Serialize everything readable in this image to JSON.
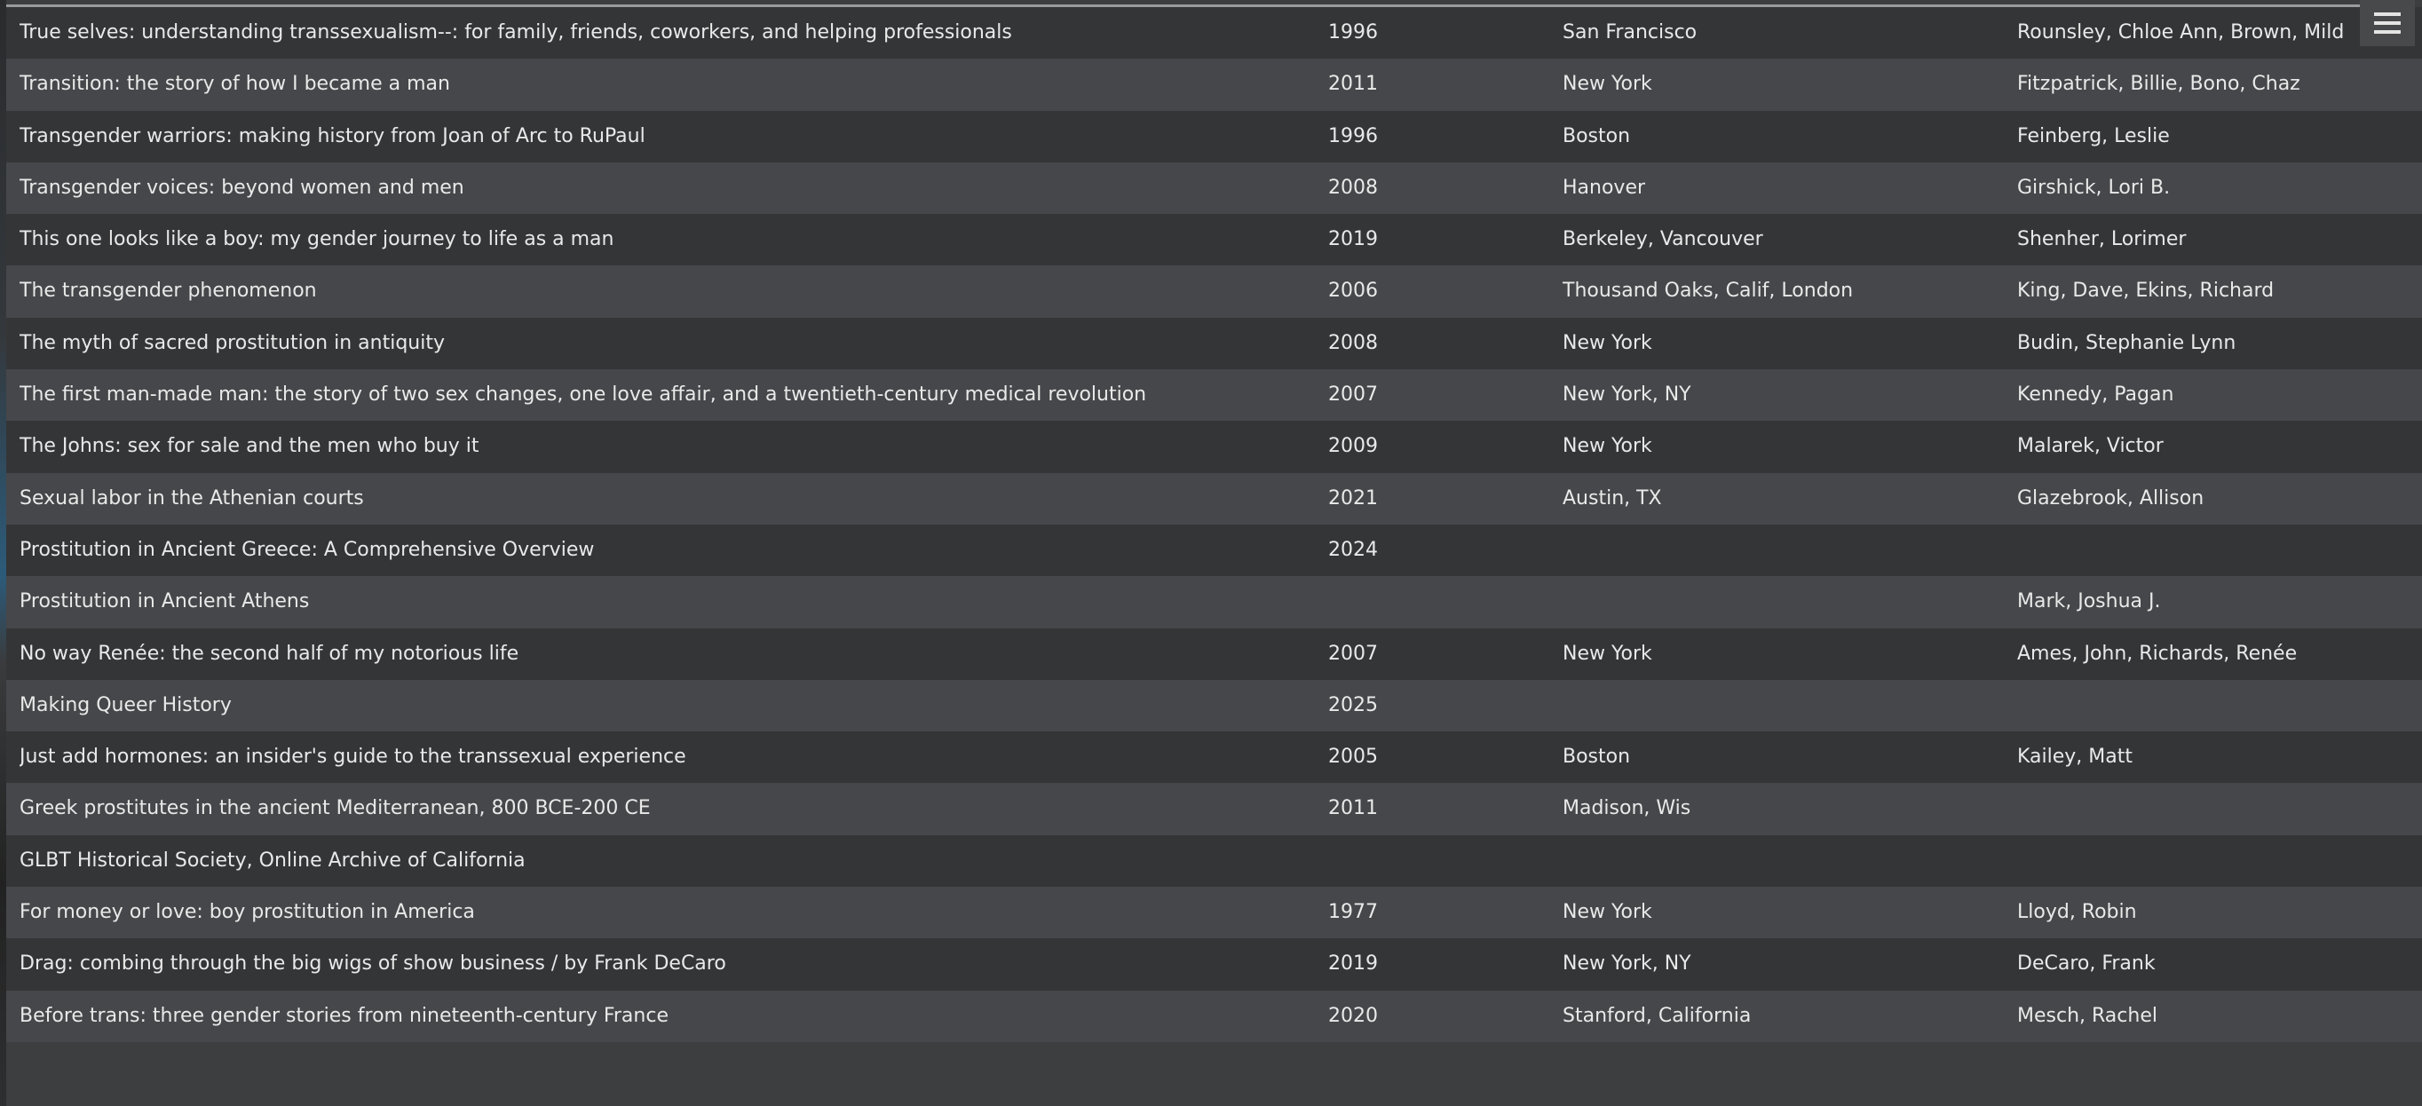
{
  "table": {
    "rows": [
      {
        "title": "True selves: understanding transsexualism--: for family, friends, coworkers, and helping professionals",
        "year": "1996",
        "place": "San Francisco",
        "author": "Rounsley, Chloe Ann, Brown, Mild"
      },
      {
        "title": "Transition: the story of how I became a man",
        "year": "2011",
        "place": "New York",
        "author": "Fitzpatrick, Billie, Bono, Chaz"
      },
      {
        "title": "Transgender warriors: making history from Joan of Arc to RuPaul",
        "year": "1996",
        "place": "Boston",
        "author": "Feinberg, Leslie"
      },
      {
        "title": "Transgender voices: beyond women and men",
        "year": "2008",
        "place": "Hanover",
        "author": "Girshick, Lori B."
      },
      {
        "title": "This one looks like a boy: my gender journey to life as a man",
        "year": "2019",
        "place": "Berkeley, Vancouver",
        "author": "Shenher, Lorimer"
      },
      {
        "title": "The transgender phenomenon",
        "year": "2006",
        "place": "Thousand Oaks, Calif, London",
        "author": "King, Dave, Ekins, Richard"
      },
      {
        "title": "The myth of sacred prostitution in antiquity",
        "year": "2008",
        "place": "New York",
        "author": "Budin, Stephanie Lynn"
      },
      {
        "title": "The first man-made man: the story of two sex changes, one love affair, and a twentieth-century medical revolution",
        "year": "2007",
        "place": "New York, NY",
        "author": "Kennedy, Pagan"
      },
      {
        "title": "The Johns: sex for sale and the men who buy it",
        "year": "2009",
        "place": "New York",
        "author": "Malarek, Victor"
      },
      {
        "title": "Sexual labor in the Athenian courts",
        "year": "2021",
        "place": "Austin, TX",
        "author": "Glazebrook, Allison"
      },
      {
        "title": "Prostitution in Ancient Greece: A Comprehensive Overview",
        "year": "2024",
        "place": "",
        "author": ""
      },
      {
        "title": "Prostitution in Ancient Athens",
        "year": "",
        "place": "",
        "author": "Mark, Joshua J."
      },
      {
        "title": "No way Renée: the second half of my notorious life",
        "year": "2007",
        "place": "New York",
        "author": "Ames, John, Richards, Renée"
      },
      {
        "title": "Making Queer History",
        "year": "2025",
        "place": "",
        "author": ""
      },
      {
        "title": "Just add hormones: an insider's guide to the transsexual experience",
        "year": "2005",
        "place": "Boston",
        "author": "Kailey, Matt"
      },
      {
        "title": "Greek prostitutes in the ancient Mediterranean, 800 BCE-200 CE",
        "year": "2011",
        "place": "Madison, Wis",
        "author": ""
      },
      {
        "title": "GLBT Historical Society, Online Archive of California",
        "year": "",
        "place": "",
        "author": ""
      },
      {
        "title": "For money or love: boy prostitution in America",
        "year": "1977",
        "place": "New York",
        "author": "Lloyd, Robin"
      },
      {
        "title": "Drag: combing through the big wigs of show business / by Frank DeCaro",
        "year": "2019",
        "place": "New York, NY",
        "author": "DeCaro, Frank"
      },
      {
        "title": "Before trans: three gender stories from nineteenth-century France",
        "year": "2020",
        "place": "Stanford, California",
        "author": "Mesch, Rachel"
      }
    ]
  },
  "menu_button": {
    "icon": "hamburger-menu-icon"
  },
  "colors": {
    "row_dark": "#343537",
    "row_light": "#46474a",
    "text": "#e9e9e9"
  }
}
